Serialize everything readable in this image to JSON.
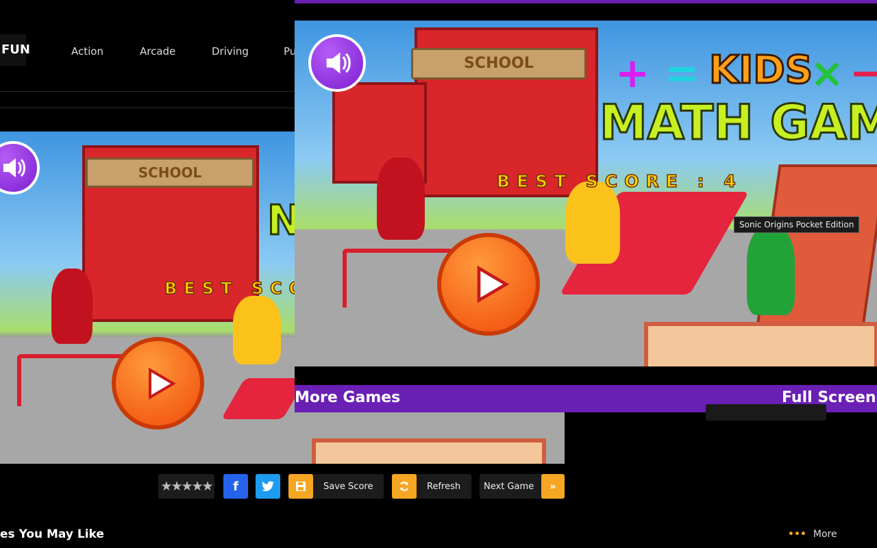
{
  "site": {
    "logo_text": "FUN"
  },
  "nav": {
    "items": [
      "Action",
      "Arcade",
      "Driving",
      "Pu"
    ]
  },
  "game": {
    "school_sign": "SCHOOL",
    "title_line1": "KIDS",
    "title_line2": "MATH GAME",
    "best_score_label": "BEST SCORE :",
    "best_score_value": "4",
    "bg_best_score_label": "BEST SCO",
    "bg_title_letter": "N",
    "symbols": {
      "plus": "+",
      "equals": "=",
      "times": "×",
      "minus": "−"
    },
    "more_games": "More Games",
    "full_screen": "Full Screen",
    "tooltip": "Sonic Origins Pocket Edition"
  },
  "toolbar": {
    "rating_stars": "★★★★★",
    "facebook_icon": "f",
    "twitter_icon": "t",
    "save_score": "Save Score",
    "refresh": "Refresh",
    "next_game": "Next Game",
    "next_icon": "»"
  },
  "footer": {
    "section_title": "es You May Like",
    "more_label": "More",
    "more_dots": "•••"
  },
  "colors": {
    "accent_purple": "#6a1fb5",
    "accent_orange": "#f5a623",
    "facebook": "#2563eb",
    "twitter": "#1d9bf0"
  }
}
